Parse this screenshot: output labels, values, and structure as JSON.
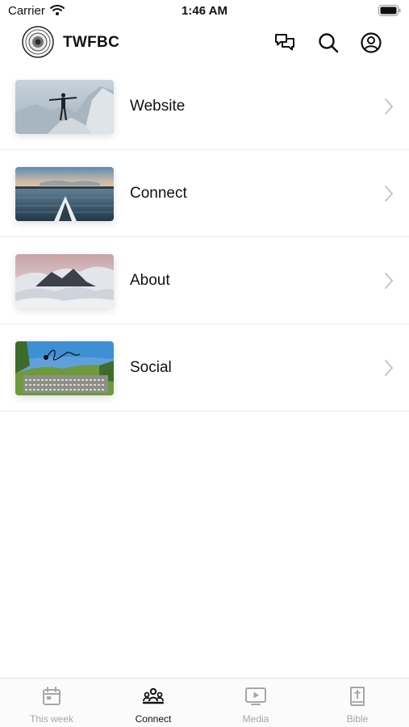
{
  "status_bar": {
    "carrier": "Carrier",
    "time": "1:46 AM"
  },
  "header": {
    "title": "TWFBC",
    "icons": [
      "chat-icon",
      "search-icon",
      "account-icon"
    ]
  },
  "menu": {
    "items": [
      {
        "label": "Website",
        "thumbnail": "person-on-mountain"
      },
      {
        "label": "Connect",
        "thumbnail": "kayak-on-lake"
      },
      {
        "label": "About",
        "thumbnail": "mountain-clouds"
      },
      {
        "label": "Social",
        "thumbnail": "group-photo"
      }
    ]
  },
  "tab_bar": {
    "tabs": [
      {
        "label": "This week",
        "icon": "calendar-icon",
        "active": false
      },
      {
        "label": "Connect",
        "icon": "people-icon",
        "active": true
      },
      {
        "label": "Media",
        "icon": "play-icon",
        "active": false
      },
      {
        "label": "Bible",
        "icon": "bible-icon",
        "active": false
      }
    ]
  },
  "colors": {
    "active": "#111111",
    "inactive": "#a7a7a7",
    "divider": "#ececec"
  }
}
